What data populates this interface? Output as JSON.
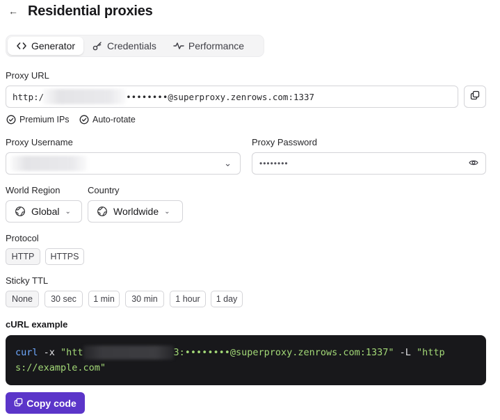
{
  "header": {
    "back_icon": "←",
    "title": "Residential proxies"
  },
  "tabs": [
    {
      "label": "Generator",
      "icon": "code-icon",
      "active": true
    },
    {
      "label": "Credentials",
      "icon": "key-icon",
      "active": false
    },
    {
      "label": "Performance",
      "icon": "activity-icon",
      "active": false
    }
  ],
  "proxy_url": {
    "label": "Proxy URL",
    "prefix": "http:/",
    "suffix": "••••••••@superproxy.zenrows.com:1337"
  },
  "features": [
    {
      "label": "Premium IPs",
      "icon": "check-circle-icon"
    },
    {
      "label": "Auto-rotate",
      "icon": "check-circle-icon"
    }
  ],
  "username": {
    "label": "Proxy Username",
    "chevron": "⌄"
  },
  "password": {
    "label": "Proxy Password",
    "value": "••••••••"
  },
  "world_region": {
    "label": "World Region",
    "value": "Global",
    "chevron": "⌄"
  },
  "country": {
    "label": "Country",
    "value": "Worldwide",
    "chevron": "⌄"
  },
  "protocol": {
    "label": "Protocol",
    "options": [
      "HTTP",
      "HTTPS"
    ],
    "selected": "HTTP"
  },
  "sticky_ttl": {
    "label": "Sticky TTL",
    "options": [
      "None",
      "30 sec",
      "1 min",
      "30 min",
      "1 hour",
      "1 day"
    ],
    "selected": "None"
  },
  "curl": {
    "label": "cURL example",
    "cmd": "curl",
    "flag_x": " -x ",
    "str_start": "\"htt",
    "str_mid": "3:••••••••@superproxy.zenrows.com:1337\"",
    "flag_l": " -L ",
    "url_part1": "\"http",
    "url_part2": "s://example.com\""
  },
  "copy_code_label": "Copy code",
  "colors": {
    "accent": "#5b35c9",
    "code_bg": "#18181b",
    "code_command": "#6ea8fe",
    "code_string": "#a3d977"
  }
}
